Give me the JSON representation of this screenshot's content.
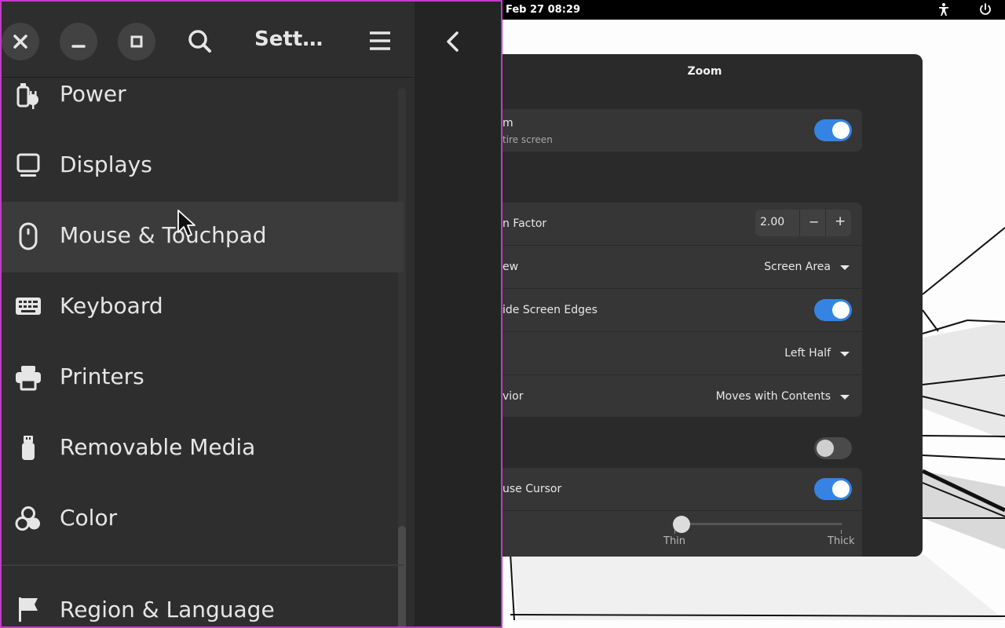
{
  "topbar": {
    "datetime": "Feb 27  08:29",
    "icons": [
      "accessibility-icon",
      "power-icon"
    ]
  },
  "zoom_dialog": {
    "title": "Zoom",
    "zoom_row": {
      "label": "m",
      "sublabel": "tire screen",
      "enabled": true
    },
    "settings_rows": [
      {
        "label": "n Factor",
        "value": "2.00",
        "kind": "spin",
        "minus": "−",
        "plus": "+"
      },
      {
        "label": "ew",
        "value": "Screen Area",
        "kind": "dropdown"
      },
      {
        "label": "ide Screen Edges",
        "kind": "toggle",
        "enabled": true
      },
      {
        "label": "",
        "value": "Left Half",
        "kind": "dropdown"
      },
      {
        "label": "vior",
        "value": "Moves with Contents",
        "kind": "dropdown"
      }
    ],
    "crosshairs_toggle": {
      "enabled": false
    },
    "cursor_row": {
      "label": "use Cursor",
      "enabled": true
    },
    "thickness": {
      "min_label": "Thin",
      "max_label": "Thick",
      "level": 0.05
    }
  },
  "settings_window": {
    "title": "Sett…",
    "buttons": [
      "close-icon",
      "minimize-icon",
      "maximize-icon",
      "search-icon",
      "menu-icon",
      "back-icon"
    ],
    "nav_items": [
      {
        "label": "Power",
        "icon": "power-plug-icon"
      },
      {
        "label": "Displays",
        "icon": "display-icon"
      },
      {
        "label": "Mouse & Touchpad",
        "icon": "mouse-icon",
        "active": true
      },
      {
        "label": "Keyboard",
        "icon": "keyboard-icon"
      },
      {
        "label": "Printers",
        "icon": "printer-icon"
      },
      {
        "label": "Removable Media",
        "icon": "usb-icon"
      },
      {
        "label": "Color",
        "icon": "color-icon"
      },
      {
        "label": "Region & Language",
        "icon": "flag-icon"
      }
    ]
  },
  "colors": {
    "accent": "#3584e4",
    "window_border": "#c03cc6"
  }
}
